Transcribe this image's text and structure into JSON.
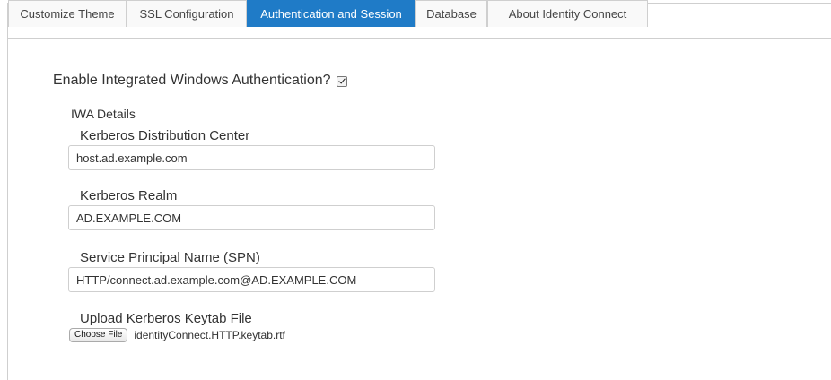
{
  "tabs": [
    {
      "label": "Customize Theme",
      "active": false
    },
    {
      "label": "SSL Configuration",
      "active": false
    },
    {
      "label": "Authentication and Session",
      "active": true
    },
    {
      "label": "Database",
      "active": false
    },
    {
      "label": "About Identity Connect",
      "active": false
    }
  ],
  "colors": {
    "active_tab": "#1f7bc7",
    "border": "#cfcfcf"
  },
  "enable_iwa": {
    "label": "Enable Integrated Windows Authentication?",
    "checked": true
  },
  "iwa_details": {
    "title": "IWA Details",
    "kdc": {
      "label": "Kerberos Distribution Center",
      "value": "host.ad.example.com"
    },
    "realm": {
      "label": "Kerberos Realm",
      "value": "AD.EXAMPLE.COM"
    },
    "spn": {
      "label": "Service Principal Name (SPN)",
      "value": "HTTP/connect.ad.example.com@AD.EXAMPLE.COM"
    },
    "keytab": {
      "label": "Upload Kerberos Keytab File",
      "button_label": "Choose File",
      "file_name": "identityConnect.HTTP.keytab.rtf"
    }
  }
}
